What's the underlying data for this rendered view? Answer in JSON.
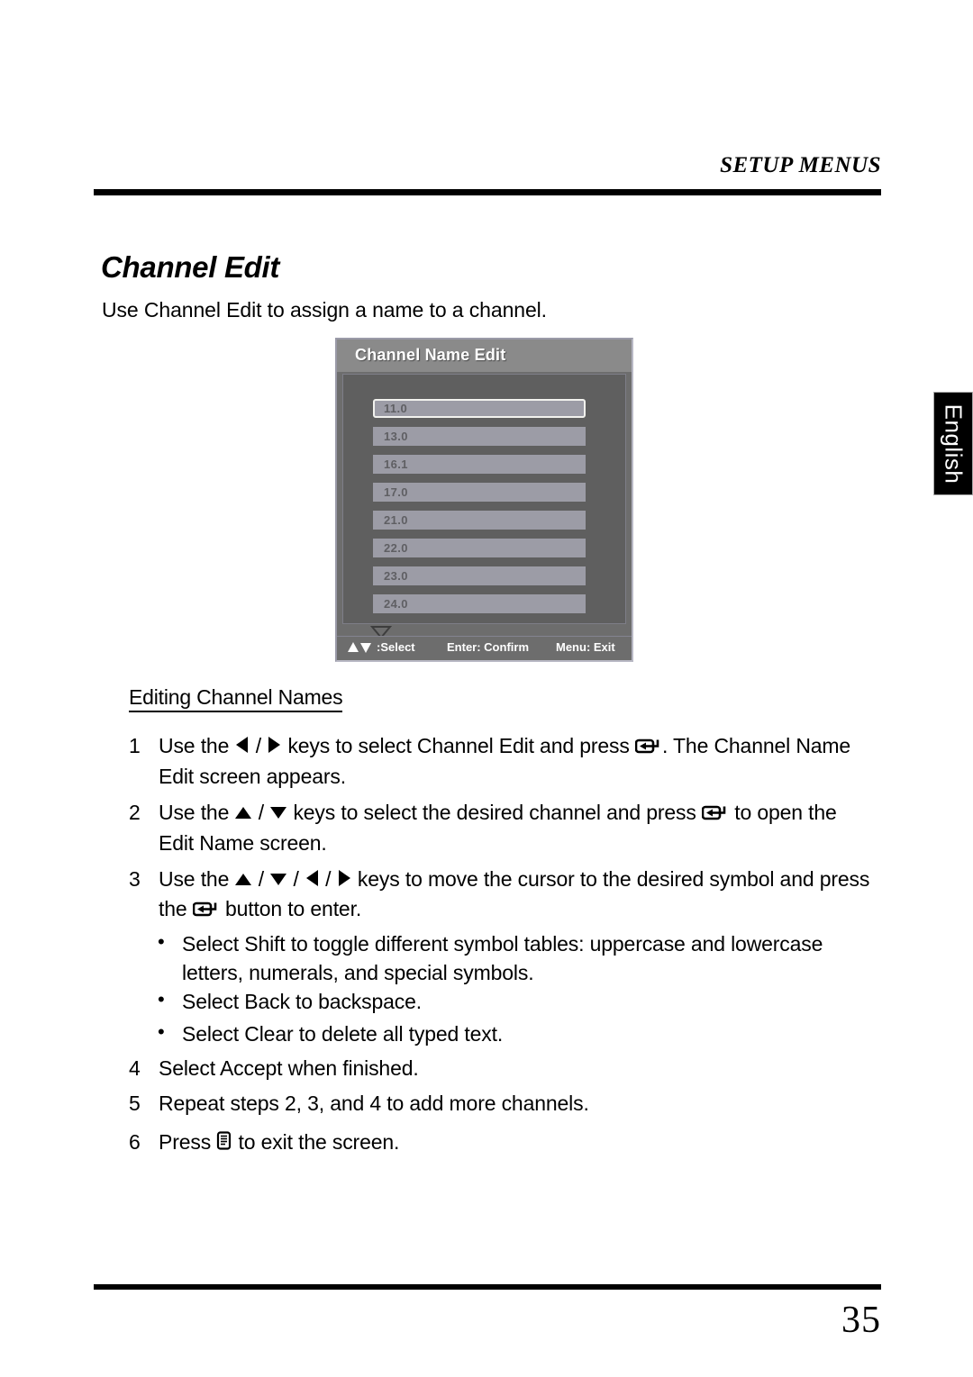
{
  "header": {
    "running_head": "SETUP MENUS"
  },
  "section": {
    "title": "Channel Edit",
    "intro": "Use Channel Edit to assign a name to a channel."
  },
  "osd": {
    "title": "Channel Name Edit",
    "channels": [
      "11.0",
      "13.0",
      "16.1",
      "17.0",
      "21.0",
      "22.0",
      "23.0",
      "24.0"
    ],
    "selected_index": 0,
    "scroll_indicator": "more-below",
    "footer": {
      "select_label": ":Select",
      "enter_label": "Enter: Confirm",
      "menu_label": "Menu: Exit"
    },
    "colors": {
      "panel_bg": "#6d6d6d",
      "titlebar_bg": "#8a8a8a",
      "body_bg": "#5f5f5f",
      "row_bg": "#9c9ca6",
      "row_text": "#5f5f63",
      "highlight_border": "#f2f2ee"
    }
  },
  "procedure": {
    "subhead": "Editing Channel Names",
    "steps": [
      {
        "number": "1",
        "part1": "Use the ",
        "part2": " keys to select Channel Edit  and press ",
        "part3": ". The Channel Name Edit screen appears."
      },
      {
        "number": "2",
        "part1": "Use the ",
        "part2": " keys to select the desired channel and press ",
        "part3": " to open the Edit Name screen."
      },
      {
        "number": "3",
        "part1": "Use the ",
        "part2": " keys to move the cursor to the desired symbol and press the ",
        "part3": " button to enter."
      },
      {
        "number": "4",
        "text": "Select Accept  when finished."
      },
      {
        "number": "5",
        "text": "Repeat steps 2, 3, and 4 to add more channels."
      },
      {
        "number": "6",
        "part1": "Press ",
        "part3": " to exit the screen."
      }
    ],
    "bullets": [
      "Select Shift  to toggle different symbol tables: uppercase and lowercase letters, numerals, and special symbols.",
      "Select Back  to backspace.",
      "Select Clear  to delete all typed text."
    ],
    "bullet_marker": "•"
  },
  "side_tab": {
    "label": "English"
  },
  "footer": {
    "page_number": "35"
  }
}
